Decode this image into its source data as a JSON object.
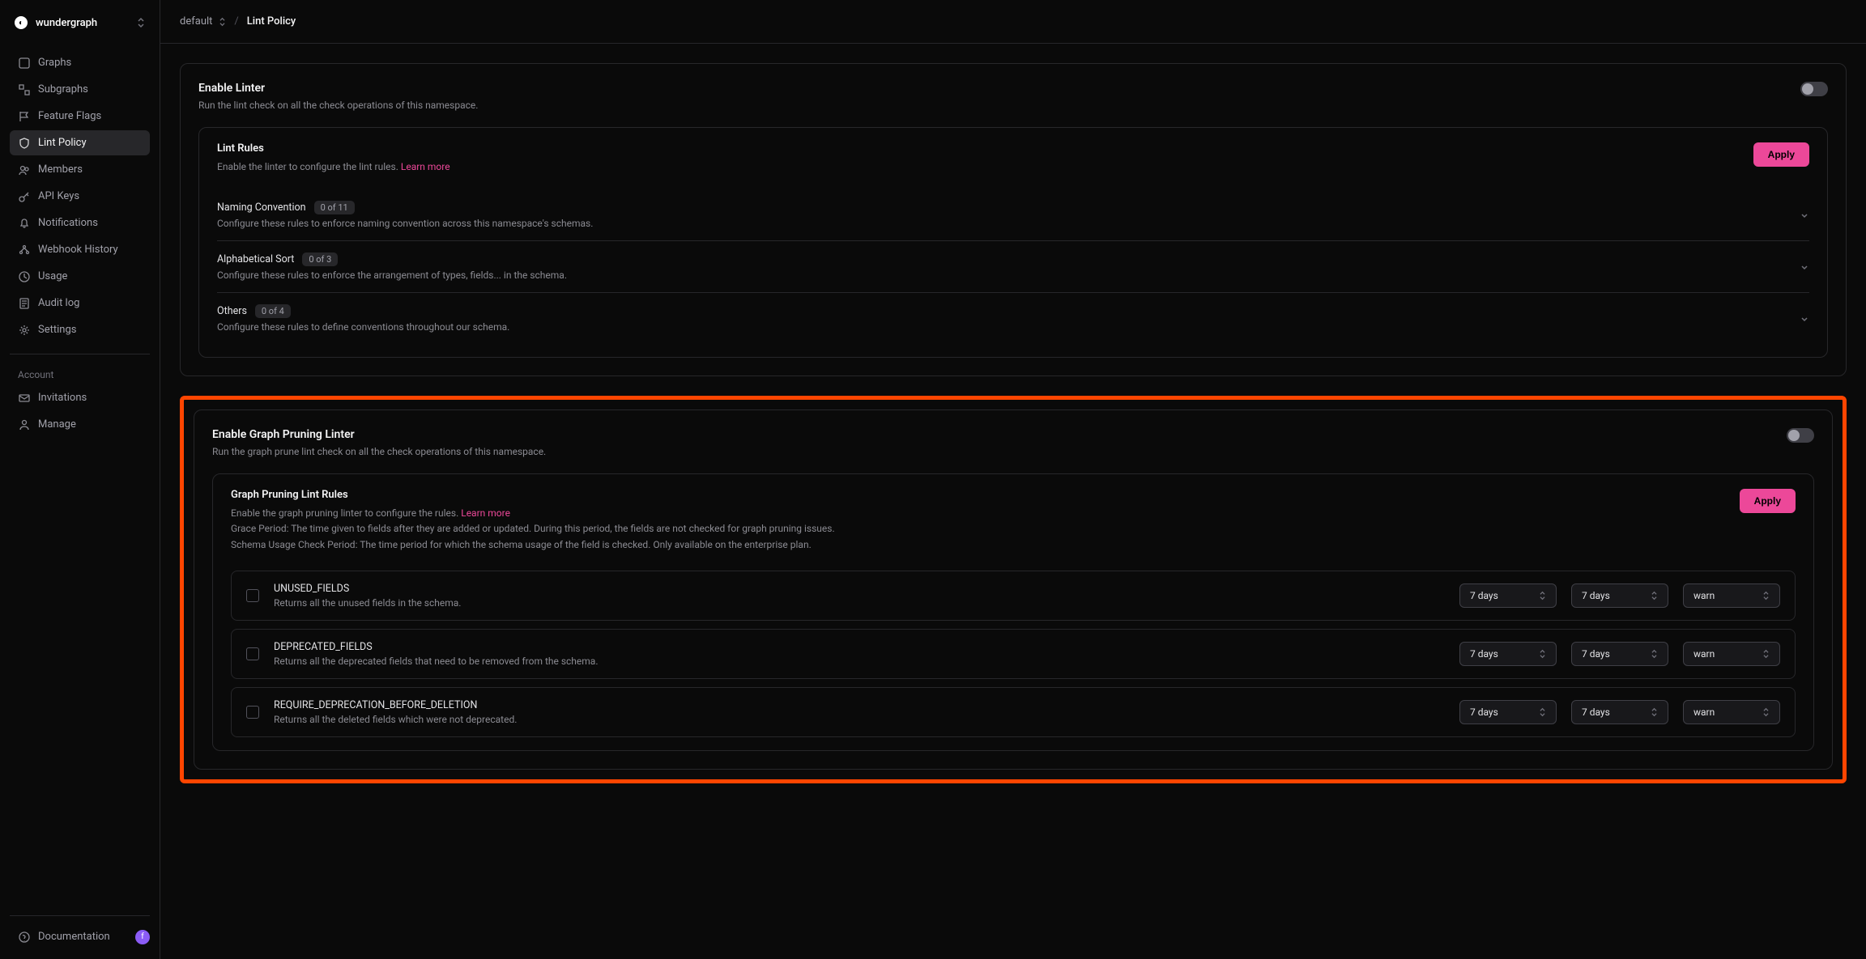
{
  "org": {
    "name": "wundergraph",
    "avatarLetter": "f"
  },
  "sidebar": {
    "primary": [
      {
        "label": "Graphs",
        "icon": "graph-icon"
      },
      {
        "label": "Subgraphs",
        "icon": "subgraph-icon"
      },
      {
        "label": "Feature Flags",
        "icon": "flag-icon"
      },
      {
        "label": "Lint Policy",
        "icon": "shield-icon"
      },
      {
        "label": "Members",
        "icon": "members-icon"
      },
      {
        "label": "API Keys",
        "icon": "key-icon"
      },
      {
        "label": "Notifications",
        "icon": "bell-icon"
      },
      {
        "label": "Webhook History",
        "icon": "webhook-icon"
      },
      {
        "label": "Usage",
        "icon": "usage-icon"
      },
      {
        "label": "Audit log",
        "icon": "audit-icon"
      },
      {
        "label": "Settings",
        "icon": "settings-icon"
      }
    ],
    "accountLabel": "Account",
    "account": [
      {
        "label": "Invitations",
        "icon": "mail-icon"
      },
      {
        "label": "Manage",
        "icon": "manage-icon"
      }
    ],
    "docLabel": "Documentation"
  },
  "breadcrumb": {
    "namespace": "default",
    "current": "Lint Policy"
  },
  "linter": {
    "title": "Enable Linter",
    "sub": "Run the lint check on all the check operations of this namespace.",
    "rules": {
      "title": "Lint Rules",
      "sub": "Enable the linter to configure the lint rules.",
      "learn": "Learn more",
      "apply": "Apply",
      "groups": [
        {
          "name": "Naming Convention",
          "count": "0 of 11",
          "desc": "Configure these rules to enforce naming convention across this namespace's schemas."
        },
        {
          "name": "Alphabetical Sort",
          "count": "0 of 3",
          "desc": "Configure these rules to enforce the arrangement of types, fields... in the schema."
        },
        {
          "name": "Others",
          "count": "0 of 4",
          "desc": "Configure these rules to define conventions throughout our schema."
        }
      ]
    }
  },
  "pruning": {
    "title": "Enable Graph Pruning Linter",
    "sub": "Run the graph prune lint check on all the check operations of this namespace.",
    "rules": {
      "title": "Graph Pruning Lint Rules",
      "sub1": "Enable the graph pruning linter to configure the rules.",
      "learn": "Learn more",
      "sub2": "Grace Period: The time given to fields after they are added or updated. During this period, the fields are not checked for graph pruning issues.",
      "sub3": "Schema Usage Check Period: The time period for which the schema usage of the field is checked. Only available on the enterprise plan.",
      "apply": "Apply",
      "items": [
        {
          "name": "UNUSED_FIELDS",
          "desc": "Returns all the unused fields in the schema.",
          "grace": "7 days",
          "period": "7 days",
          "severity": "warn"
        },
        {
          "name": "DEPRECATED_FIELDS",
          "desc": "Returns all the deprecated fields that need to be removed from the schema.",
          "grace": "7 days",
          "period": "7 days",
          "severity": "warn"
        },
        {
          "name": "REQUIRE_DEPRECATION_BEFORE_DELETION",
          "desc": "Returns all the deleted fields which were not deprecated.",
          "grace": "7 days",
          "period": "7 days",
          "severity": "warn"
        }
      ]
    }
  }
}
